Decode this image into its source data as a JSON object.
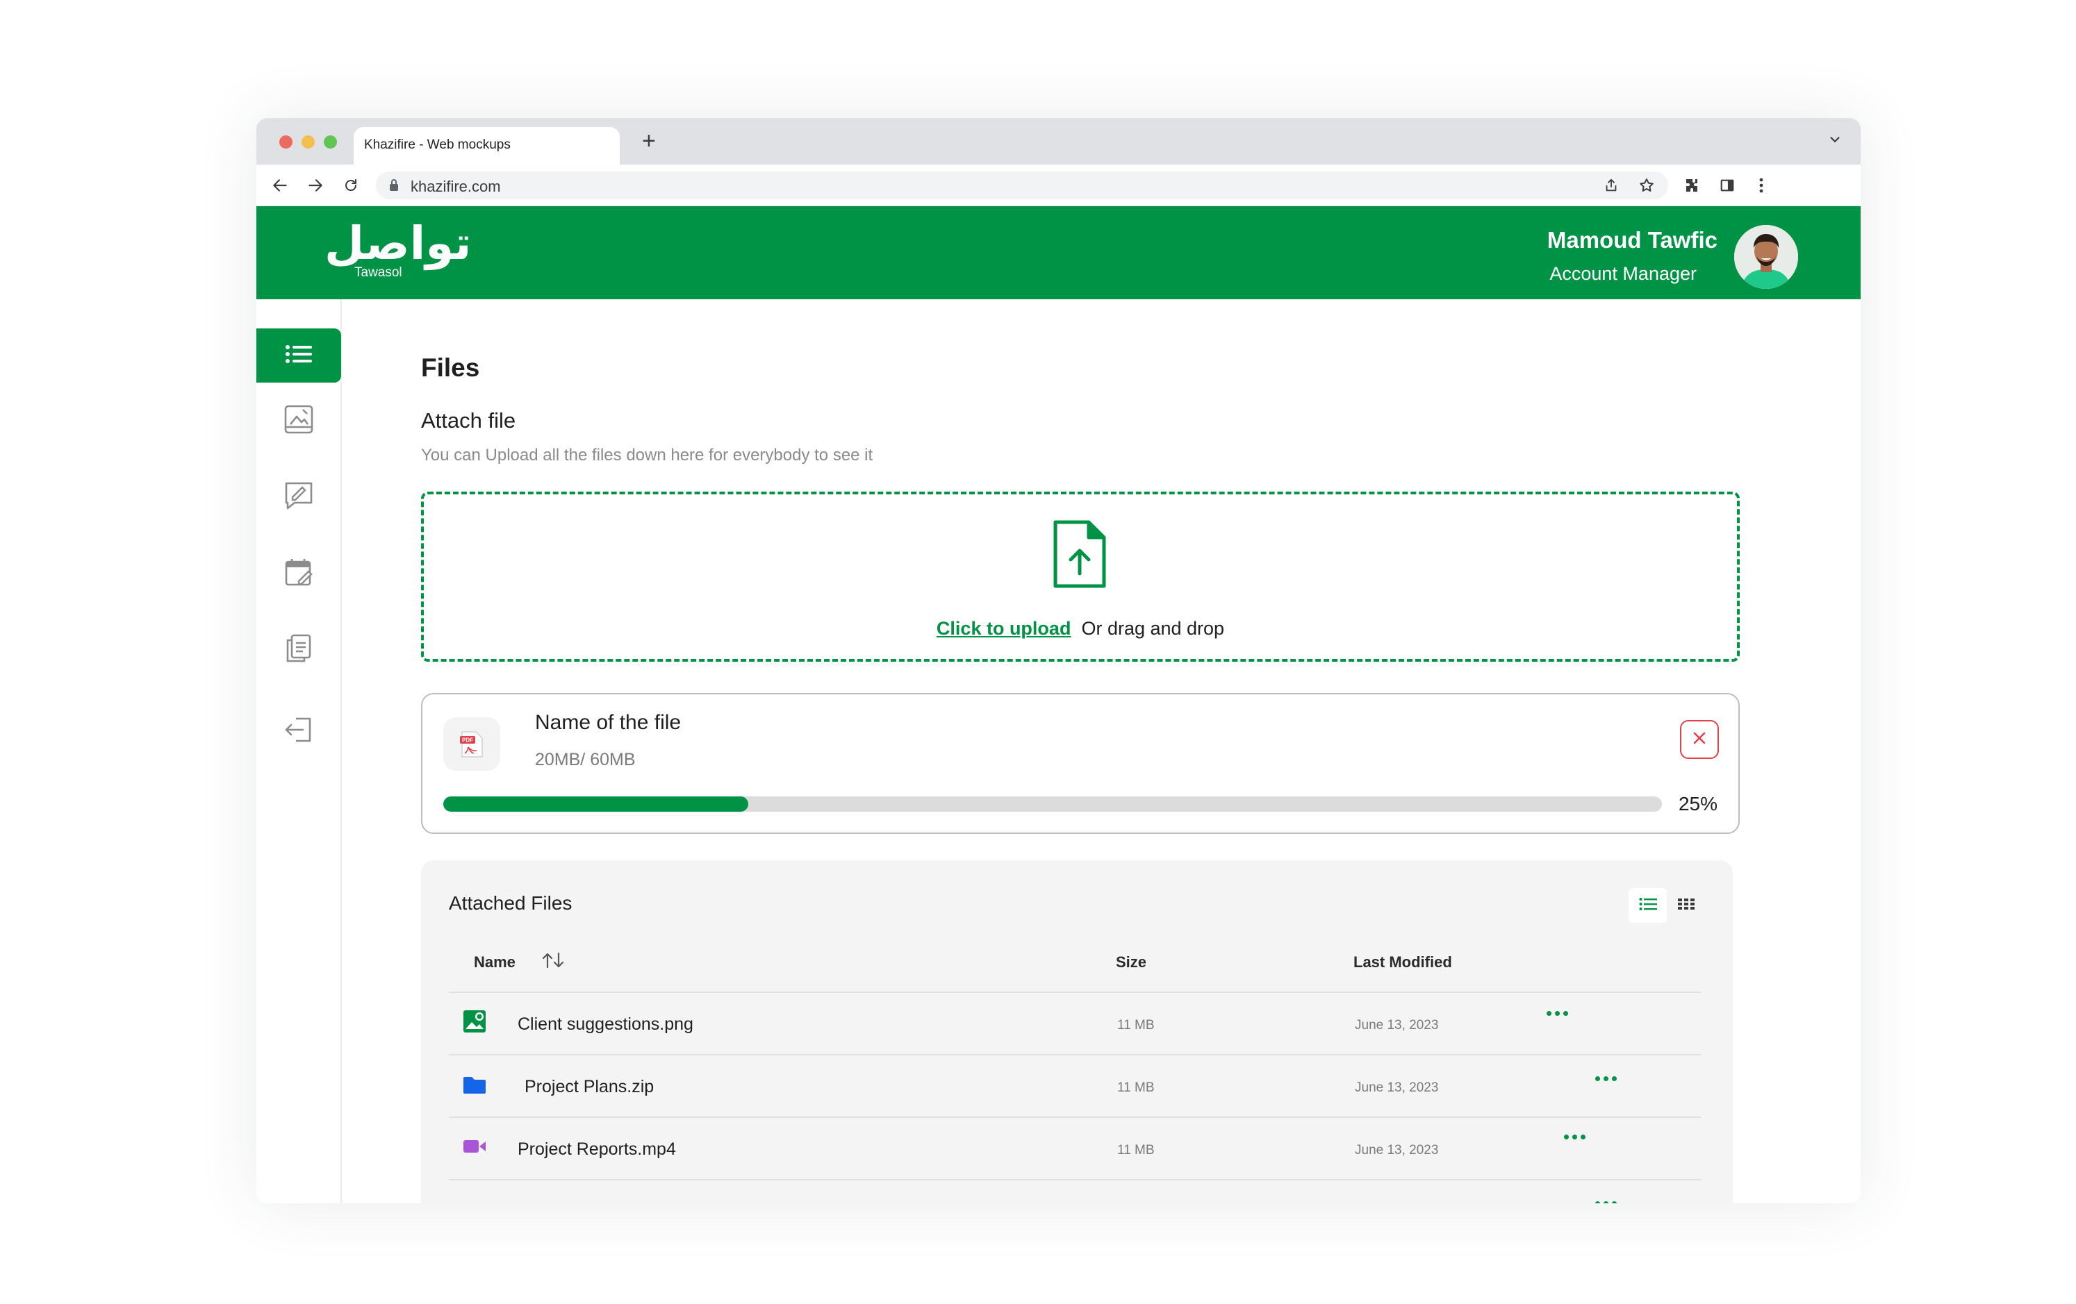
{
  "browser": {
    "tab_title": "Khazifire - Web mockups",
    "new_tab_label": "+",
    "url": "khazifire.com"
  },
  "brand": {
    "logo_arabic": "تواصل",
    "logo_latin": "Tawasol",
    "accent": "#009245",
    "danger": "#e0414a"
  },
  "user": {
    "name": "Mamoud Tawfic",
    "role": "Account Manager"
  },
  "sidebar": {
    "items": [
      {
        "icon": "list-icon",
        "active": true
      },
      {
        "icon": "image-edit-icon"
      },
      {
        "icon": "message-edit-icon"
      },
      {
        "icon": "calendar-edit-icon"
      },
      {
        "icon": "documents-icon"
      },
      {
        "icon": "logout-icon"
      }
    ]
  },
  "page": {
    "title": "Files",
    "section_title": "Attach file",
    "section_subtitle": "You can Upload all the files down here for everybody to see it"
  },
  "dropzone": {
    "link_text": "Click to upload",
    "rest_text": "Or drag and drop"
  },
  "upload": {
    "file_name": "Name of the file",
    "size_text": "20MB/ 60MB",
    "progress": 0.25,
    "progress_label": "25%",
    "badge_text": "PDF"
  },
  "attached": {
    "title": "Attached Files",
    "columns": {
      "name": "Name",
      "size": "Size",
      "modified": "Last Modified"
    },
    "rows": [
      {
        "icon": "image-file-icon",
        "name": "Client suggestions.png",
        "size": "11 MB",
        "date": "June 13, 2023"
      },
      {
        "icon": "folder-icon",
        "name": "Project Plans.zip",
        "size": "11 MB",
        "date": "June 13, 2023"
      },
      {
        "icon": "video-icon",
        "name": "Project Reports.mp4",
        "size": "11 MB",
        "date": "June 13, 2023"
      }
    ]
  }
}
